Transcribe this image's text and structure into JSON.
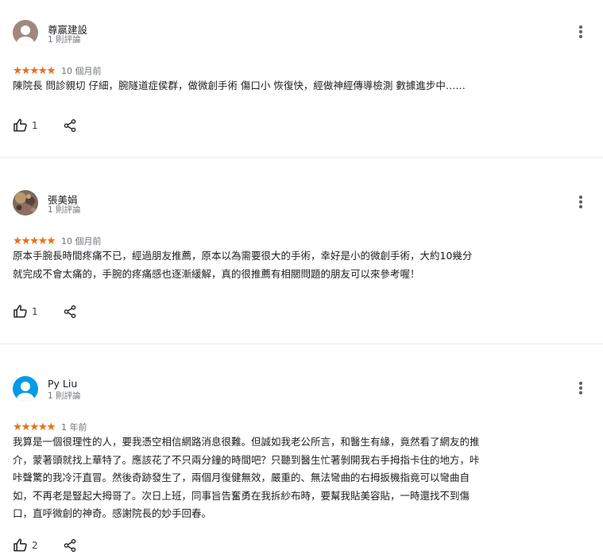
{
  "reviews": [
    {
      "name": "尊嬴建設",
      "review_count": "1 則評論",
      "stars": "★★★★★",
      "rating": 5,
      "time": "10 個月前",
      "text": "陳院長 問診親切 仔細，腕隧道症侯群，做微創手術 傷口小 恢復快，經做神經傳導檢測 數據進步中……",
      "likes": "1",
      "avatar_color": "#a1887f"
    },
    {
      "name": "張美娟",
      "review_count": "1 則評論",
      "stars": "★★★★★",
      "rating": 5,
      "time": "10 個月前",
      "text": "原本手腕長時間疼痛不已，經過朋友推薦，原本以為需要很大的手術，幸好是小的微創手術，大約10幾分\n就完成不會太痛的，手腕的疼痛感也逐漸緩解，真的很推薦有相關問題的朋友可以來參考喔！",
      "likes": "1",
      "avatar_color": "#6d4c41"
    },
    {
      "name": "Py Liu",
      "review_count": "1 則評論",
      "stars": "★★★★★",
      "rating": 5,
      "time": "1 年前",
      "text": "我算是一個很理性的人，要我憑空相信網路消息很難。但誠如我老公所言，和醫生有緣，竟然看了網友的推\n介，蒙著頭就找上華特了。應該花了不只兩分鐘的時間吧？只聽到醫生忙著剝開我右手拇指卡住的地方，咔\n咔聲驚的我冷汗直冒。然後奇跡發生了，兩個月復健無效，嚴重的、無法彎曲的右拇扳機指竟可以彎曲自\n如，不再老是豎起大拇哥了。次日上班，同事旨告奮勇在我拆紗布時，要幫我貼美容貼，一時還找不到傷\n口，直呼微創的神奇。感謝院長的妙手回春。",
      "likes": "2",
      "avatar_color": "#039be5"
    }
  ],
  "icons": {
    "like": "thumb-up-icon",
    "share": "share-icon",
    "more": "more-vert-icon",
    "star": "star-icon"
  },
  "colors": {
    "star": "#e7711b",
    "text": "#202124",
    "secondary": "#70757a",
    "divider": "#e8eaed"
  }
}
